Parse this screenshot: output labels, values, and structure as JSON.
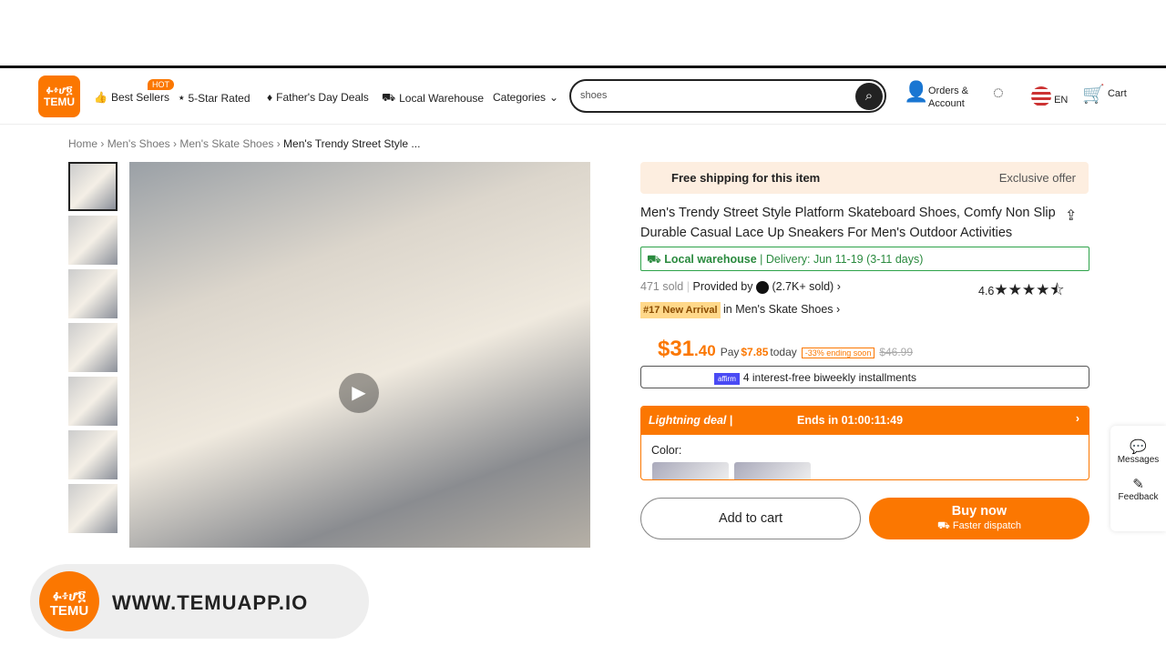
{
  "header": {
    "logo": "TEMU",
    "logo_glyphs": "ፉ፥ሆ፬",
    "hot": "HOT",
    "nav": [
      "Best Sellers",
      "5-Star Rated",
      "Father's Day Deals",
      "Local Warehouse",
      "Categories"
    ],
    "search_value": "shoes",
    "orders": "Orders &",
    "account": "Account",
    "lang": "EN",
    "cart": "Cart"
  },
  "breadcrumb": [
    "Home",
    "Men's Shoes",
    "Men's Skate Shoes",
    "Men's Trendy Street Style ..."
  ],
  "product": {
    "free_shipping": "Free shipping for this item",
    "exclusive": "Exclusive offer",
    "title": "Men's Trendy Street Style Platform Skateboard Shoes, Comfy Non Slip Durable Casual Lace Up Sneakers For Men's Outdoor Activities",
    "local_warehouse": "Local warehouse",
    "delivery": "Delivery: Jun 11-19 (3-11 days)",
    "sold": "471 sold",
    "provided_by": "Provided by",
    "seller_sold": "(2.7K+ sold)",
    "rating": "4.6",
    "rating_value": 4.6,
    "rank_badge": "#17 New Arrival",
    "rank_text": "in Men's Skate Shoes",
    "price_dollar": "$31",
    "price_cents": ".40",
    "pay": "Pay",
    "pay_amount": "$7.85",
    "today": "today",
    "discount": "-33% ending soon",
    "original_price": "$46.99",
    "affirm": "affirm",
    "installments": "4 interest-free biweekly installments",
    "deal_label": "Lightning deal",
    "deal_ends": "Ends in 01:00:11:49",
    "color_label": "Color:",
    "add_to_cart": "Add to cart",
    "buy_now": "Buy now",
    "faster_dispatch": "Faster dispatch"
  },
  "side": {
    "messages": "Messages",
    "feedback": "Feedback"
  },
  "promo": {
    "url": "WWW.TEMUAPP.IO",
    "logo": "TEMU"
  },
  "colors": {
    "accent": "#fb7701",
    "green": "#2ea34a"
  }
}
